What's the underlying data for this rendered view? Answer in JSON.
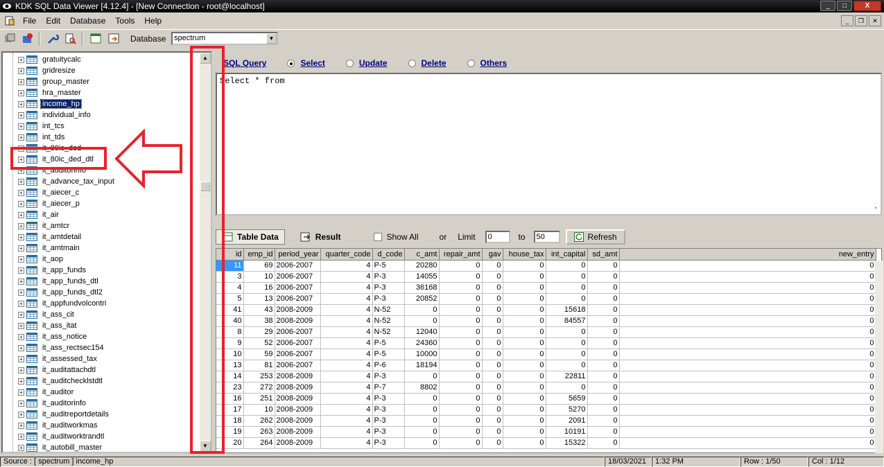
{
  "window": {
    "title": "KDK SQL Data Viewer [4.12.4] - [New Connection - root@localhost]",
    "min_label": "_",
    "max_label": "□",
    "close_label": "X"
  },
  "menu": [
    "File",
    "Edit",
    "Database",
    "Tools",
    "Help"
  ],
  "toolbar": {
    "database_label": "Database",
    "database_value": "spectrum"
  },
  "tree": {
    "items": [
      {
        "label": "gratuitycalc"
      },
      {
        "label": "gridresize"
      },
      {
        "label": "group_master"
      },
      {
        "label": "hra_master"
      },
      {
        "label": "income_hp",
        "selected": true
      },
      {
        "label": "individual_info"
      },
      {
        "label": "int_tcs"
      },
      {
        "label": "int_tds"
      },
      {
        "label": "it_80ic_ded"
      },
      {
        "label": "it_80ic_ded_dtl"
      },
      {
        "label": "it_auditorinfo"
      },
      {
        "label": "it_advance_tax_input"
      },
      {
        "label": "it_aiecer_c"
      },
      {
        "label": "it_aiecer_p"
      },
      {
        "label": "it_air"
      },
      {
        "label": "it_amtcr"
      },
      {
        "label": "it_amtdetail"
      },
      {
        "label": "it_amtmain"
      },
      {
        "label": "it_aop"
      },
      {
        "label": "it_app_funds"
      },
      {
        "label": "it_app_funds_dtl"
      },
      {
        "label": "it_app_funds_dtl2"
      },
      {
        "label": "it_appfundvolcontri"
      },
      {
        "label": "it_ass_cit"
      },
      {
        "label": "it_ass_itat"
      },
      {
        "label": "it_ass_notice"
      },
      {
        "label": "it_ass_rectsec154"
      },
      {
        "label": "it_assessed_tax"
      },
      {
        "label": "it_auditattachdtl"
      },
      {
        "label": "it_auditchecklstdtl"
      },
      {
        "label": "it_auditor"
      },
      {
        "label": "it_auditorinfo"
      },
      {
        "label": "it_auditreportdetails"
      },
      {
        "label": "it_auditworkmas"
      },
      {
        "label": "it_auditworktrandtl"
      },
      {
        "label": "it_autobill_master"
      }
    ]
  },
  "query": {
    "title": "SQL Query",
    "modes": [
      {
        "label": "Select",
        "checked": true
      },
      {
        "label": "Update",
        "checked": false
      },
      {
        "label": "Delete",
        "checked": false
      },
      {
        "label": "Others",
        "checked": false
      }
    ],
    "text": "Select * from"
  },
  "results": {
    "tab_table": "Table Data",
    "tab_result": "Result",
    "show_all_label": "Show All",
    "or_label": "or",
    "limit_label": "Limit",
    "limit_from": "0",
    "to_label": "to",
    "limit_to": "50",
    "refresh_label": "Refresh",
    "columns": [
      "id",
      "emp_id",
      "period_year",
      "quarter_code",
      "d_code",
      "c_amt",
      "repair_amt",
      "gav",
      "house_tax",
      "int_capital",
      "sd_amt",
      "new_entry"
    ],
    "rows": [
      [
        "11",
        "69",
        "2006-2007",
        "4",
        "P-5",
        "20280",
        "0",
        "0",
        "0",
        "0",
        "0",
        "0"
      ],
      [
        "3",
        "10",
        "2006-2007",
        "4",
        "P-3",
        "14055",
        "0",
        "0",
        "0",
        "0",
        "0",
        "0"
      ],
      [
        "4",
        "16",
        "2006-2007",
        "4",
        "P-3",
        "36168",
        "0",
        "0",
        "0",
        "0",
        "0",
        "0"
      ],
      [
        "5",
        "13",
        "2006-2007",
        "4",
        "P-3",
        "20852",
        "0",
        "0",
        "0",
        "0",
        "0",
        "0"
      ],
      [
        "41",
        "43",
        "2008-2009",
        "4",
        "N-52",
        "0",
        "0",
        "0",
        "0",
        "15618",
        "0",
        "0"
      ],
      [
        "40",
        "38",
        "2008-2009",
        "4",
        "N-52",
        "0",
        "0",
        "0",
        "0",
        "84557",
        "0",
        "0"
      ],
      [
        "8",
        "29",
        "2006-2007",
        "4",
        "N-52",
        "12040",
        "0",
        "0",
        "0",
        "0",
        "0",
        "0"
      ],
      [
        "9",
        "52",
        "2006-2007",
        "4",
        "P-5",
        "24360",
        "0",
        "0",
        "0",
        "0",
        "0",
        "0"
      ],
      [
        "10",
        "59",
        "2006-2007",
        "4",
        "P-5",
        "10000",
        "0",
        "0",
        "0",
        "0",
        "0",
        "0"
      ],
      [
        "13",
        "81",
        "2006-2007",
        "4",
        "P-6",
        "18194",
        "0",
        "0",
        "0",
        "0",
        "0",
        "0"
      ],
      [
        "14",
        "253",
        "2008-2009",
        "4",
        "P-3",
        "0",
        "0",
        "0",
        "0",
        "22811",
        "0",
        "0"
      ],
      [
        "23",
        "272",
        "2008-2009",
        "4",
        "P-7",
        "8802",
        "0",
        "0",
        "0",
        "0",
        "0",
        "0"
      ],
      [
        "16",
        "251",
        "2008-2009",
        "4",
        "P-3",
        "0",
        "0",
        "0",
        "0",
        "5659",
        "0",
        "0"
      ],
      [
        "17",
        "10",
        "2008-2009",
        "4",
        "P-3",
        "0",
        "0",
        "0",
        "0",
        "5270",
        "0",
        "0"
      ],
      [
        "18",
        "262",
        "2008-2009",
        "4",
        "P-3",
        "0",
        "0",
        "0",
        "0",
        "2091",
        "0",
        "0"
      ],
      [
        "19",
        "263",
        "2008-2009",
        "4",
        "P-3",
        "0",
        "0",
        "0",
        "0",
        "10191",
        "0",
        "0"
      ],
      [
        "20",
        "264",
        "2008-2009",
        "4",
        "P-3",
        "0",
        "0",
        "0",
        "0",
        "15322",
        "0",
        "0"
      ]
    ]
  },
  "status": {
    "source": "Source : [ spectrum ] income_hp",
    "date": "18/03/2021",
    "time": "1:32 PM",
    "row": "Row : 1/50",
    "col": "Col : 1/12"
  },
  "colors": {
    "annotation_red": "#e8222a",
    "selection_blue": "#0a246a",
    "grid_selection": "#3399ff"
  }
}
